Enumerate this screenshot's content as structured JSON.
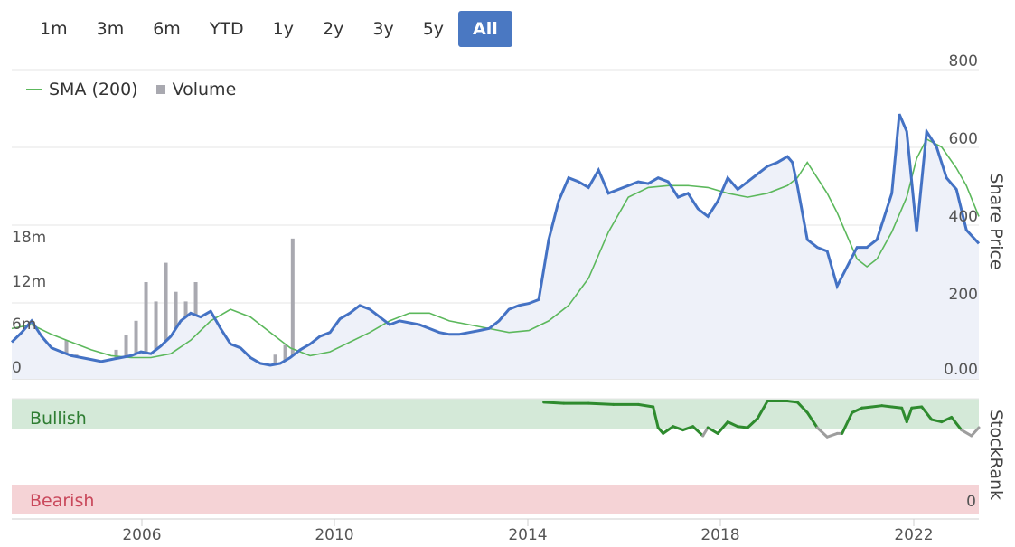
{
  "range_selector": {
    "buttons": [
      "1m",
      "3m",
      "6m",
      "YTD",
      "1y",
      "2y",
      "3y",
      "5y",
      "All"
    ],
    "selected": "All"
  },
  "legend": {
    "sma_label": "SMA (200)",
    "volume_label": "Volume"
  },
  "colors": {
    "price": "#4472c4",
    "price_fill": "#eef1f9",
    "sma": "#5cb85c",
    "volume": "#a9a9b0",
    "bullish_band": "#d4e9d8",
    "bearish_band": "#f5d3d6",
    "stockrank": "#2e8b2e",
    "stockrank_low": "#9e9e9e",
    "active_button": "#4a78c2"
  },
  "chart_data": {
    "type": "line",
    "x_range": [
      2003.9,
      2023.35
    ],
    "x_ticks": [
      "2006",
      "2010",
      "2014",
      "2018",
      "2022"
    ],
    "price_axis": {
      "label": "Share Price",
      "range": [
        0,
        800
      ],
      "ticks": [
        "0.00",
        "200",
        "400",
        "600",
        "800"
      ]
    },
    "volume_axis": {
      "range": [
        0,
        20000000
      ],
      "ticks": [
        "0",
        "6m",
        "12m",
        "18m"
      ]
    },
    "stockrank_axis": {
      "label": "StockRank",
      "range": [
        0,
        100
      ],
      "ticks": [
        "0"
      ],
      "bands": {
        "top": "Bullish",
        "bottom": "Bearish"
      }
    },
    "series": [
      {
        "name": "Share Price",
        "type": "line",
        "x": [
          2003.9,
          2004.1,
          2004.3,
          2004.5,
          2004.7,
          2004.9,
          2005.1,
          2005.3,
          2005.5,
          2005.7,
          2005.9,
          2006.1,
          2006.3,
          2006.5,
          2006.7,
          2006.9,
          2007.1,
          2007.3,
          2007.5,
          2007.7,
          2007.9,
          2008.1,
          2008.3,
          2008.5,
          2008.7,
          2008.9,
          2009.1,
          2009.3,
          2009.5,
          2009.7,
          2009.9,
          2010.1,
          2010.3,
          2010.5,
          2010.7,
          2010.9,
          2011.1,
          2011.3,
          2011.5,
          2011.7,
          2011.9,
          2012.1,
          2012.3,
          2012.5,
          2012.7,
          2012.9,
          2013.1,
          2013.3,
          2013.5,
          2013.7,
          2013.9,
          2014.1,
          2014.3,
          2014.5,
          2014.7,
          2014.9,
          2015.1,
          2015.3,
          2015.5,
          2015.7,
          2015.9,
          2016.1,
          2016.3,
          2016.5,
          2016.7,
          2016.9,
          2017.1,
          2017.3,
          2017.5,
          2017.7,
          2017.9,
          2018.1,
          2018.3,
          2018.5,
          2018.7,
          2018.9,
          2019.1,
          2019.3,
          2019.5,
          2019.6,
          2019.7,
          2019.9,
          2020.1,
          2020.3,
          2020.5,
          2020.7,
          2020.9,
          2021.1,
          2021.3,
          2021.45,
          2021.6,
          2021.75,
          2021.9,
          2022.1,
          2022.3,
          2022.5,
          2022.7,
          2022.9,
          2023.1,
          2023.35
        ],
        "y": [
          95,
          120,
          150,
          110,
          80,
          70,
          60,
          55,
          50,
          45,
          50,
          55,
          60,
          70,
          65,
          85,
          110,
          150,
          170,
          160,
          175,
          130,
          90,
          80,
          55,
          40,
          35,
          40,
          55,
          75,
          90,
          110,
          120,
          155,
          170,
          190,
          180,
          160,
          140,
          150,
          145,
          140,
          130,
          120,
          115,
          115,
          120,
          125,
          130,
          150,
          180,
          190,
          195,
          205,
          360,
          460,
          520,
          510,
          495,
          540,
          480,
          490,
          500,
          510,
          505,
          520,
          510,
          470,
          480,
          440,
          420,
          460,
          520,
          490,
          510,
          530,
          550,
          560,
          575,
          560,
          500,
          360,
          340,
          330,
          240,
          290,
          340,
          340,
          360,
          420,
          480,
          685,
          640,
          380,
          640,
          600,
          520,
          490,
          385,
          350
        ]
      },
      {
        "name": "SMA (200)",
        "type": "line",
        "x": [
          2003.9,
          2004.3,
          2004.7,
          2005.1,
          2005.5,
          2005.9,
          2006.3,
          2006.7,
          2007.1,
          2007.5,
          2007.9,
          2008.3,
          2008.7,
          2009.1,
          2009.5,
          2009.9,
          2010.3,
          2010.7,
          2011.1,
          2011.5,
          2011.9,
          2012.3,
          2012.7,
          2013.1,
          2013.5,
          2013.9,
          2014.3,
          2014.7,
          2015.1,
          2015.5,
          2015.9,
          2016.3,
          2016.7,
          2017.1,
          2017.5,
          2017.9,
          2018.3,
          2018.7,
          2019.1,
          2019.5,
          2019.7,
          2019.9,
          2020.1,
          2020.3,
          2020.5,
          2020.7,
          2020.9,
          2021.1,
          2021.3,
          2021.6,
          2021.9,
          2022.1,
          2022.3,
          2022.6,
          2022.9,
          2023.1,
          2023.35
        ],
        "y": [
          130,
          140,
          115,
          95,
          75,
          60,
          55,
          55,
          65,
          100,
          150,
          180,
          160,
          120,
          80,
          60,
          70,
          95,
          120,
          150,
          170,
          170,
          150,
          140,
          130,
          120,
          125,
          150,
          190,
          260,
          380,
          470,
          495,
          500,
          500,
          495,
          480,
          470,
          480,
          500,
          520,
          560,
          520,
          480,
          430,
          370,
          310,
          290,
          310,
          380,
          470,
          570,
          620,
          600,
          545,
          500,
          420
        ]
      },
      {
        "name": "Volume",
        "type": "bar",
        "unit": "shares",
        "x": [
          2004.0,
          2004.2,
          2004.4,
          2004.6,
          2004.8,
          2005.0,
          2005.2,
          2005.4,
          2005.6,
          2005.8,
          2006.0,
          2006.2,
          2006.4,
          2006.6,
          2006.8,
          2007.0,
          2007.2,
          2007.4,
          2007.6,
          2007.8,
          2008.0,
          2008.2,
          2008.4,
          2008.6,
          2008.8,
          2009.0,
          2009.2,
          2009.4,
          2009.55,
          2009.8,
          2010.0,
          2010.3,
          2010.6,
          2010.9,
          2011.2,
          2011.5,
          2011.8,
          2012.2,
          2012.6,
          2013.0,
          2013.5,
          2013.9,
          2014.3,
          2014.8,
          2015.2,
          2015.6,
          2016.0,
          2016.4,
          2016.8,
          2017.2,
          2017.6,
          2018.0,
          2018.4,
          2018.8,
          2019.2,
          2019.6,
          2020.0,
          2020.4,
          2020.8,
          2021.2,
          2021.6,
          2022.0,
          2022.5,
          2023.0
        ],
        "y": [
          1500000,
          2500000,
          4500000,
          3500000,
          2000000,
          4000000,
          2500000,
          2000000,
          1000000,
          2000000,
          3000000,
          4500000,
          6000000,
          10000000,
          8000000,
          12000000,
          9000000,
          8000000,
          10000000,
          6000000,
          4500000,
          3000000,
          2500000,
          1500000,
          1200000,
          1000000,
          2500000,
          3500000,
          14500000,
          3000000,
          2500000,
          1500000,
          2000000,
          1500000,
          1000000,
          1200000,
          800000,
          1000000,
          900000,
          1000000,
          1000000,
          1200000,
          800000,
          700000,
          1500000,
          1000000,
          2500000,
          1500000,
          1200000,
          1000000,
          1500000,
          900000,
          800000,
          700000,
          1000000,
          800000,
          1500000,
          2000000,
          1000000,
          1000000,
          500000,
          1200000,
          800000,
          1000000
        ]
      },
      {
        "name": "StockRank",
        "type": "line",
        "axis": "stockrank",
        "x": [
          2014.6,
          2015.0,
          2015.5,
          2016.0,
          2016.5,
          2016.8,
          2016.9,
          2017.0,
          2017.2,
          2017.4,
          2017.6,
          2017.8,
          2017.9,
          2018.1,
          2018.3,
          2018.5,
          2018.7,
          2018.9,
          2019.1,
          2019.3,
          2019.5,
          2019.7,
          2019.9,
          2020.1,
          2020.3,
          2020.5,
          2020.6,
          2020.8,
          2021.0,
          2021.2,
          2021.4,
          2021.6,
          2021.8,
          2021.9,
          2022.0,
          2022.2,
          2022.4,
          2022.6,
          2022.8,
          2023.0,
          2023.2,
          2023.35
        ],
        "y": [
          97,
          96,
          96,
          95,
          95,
          93,
          75,
          70,
          76,
          73,
          76,
          68,
          75,
          70,
          80,
          76,
          75,
          83,
          98,
          98,
          98,
          97,
          88,
          75,
          67,
          70,
          70,
          88,
          92,
          93,
          94,
          93,
          92,
          80,
          92,
          93,
          82,
          80,
          84,
          73,
          68,
          75
        ]
      }
    ]
  }
}
